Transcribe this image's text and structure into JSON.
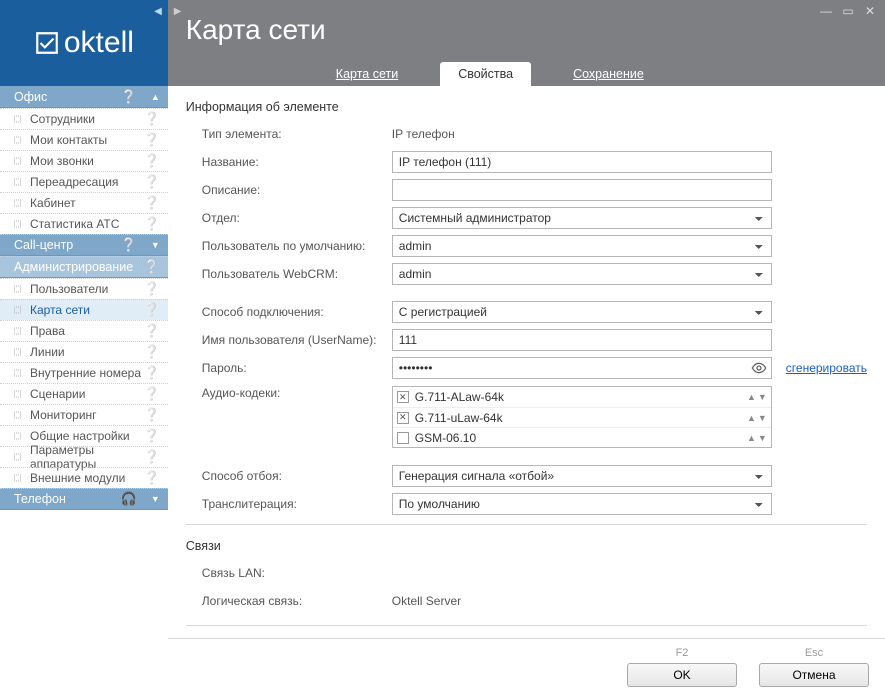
{
  "brand": {
    "name": "oktell"
  },
  "sidebar": {
    "sections": [
      {
        "label": "Офис",
        "style": "dark",
        "expanded": true,
        "items": [
          {
            "label": "Сотрудники"
          },
          {
            "label": "Мои контакты"
          },
          {
            "label": "Мои звонки"
          },
          {
            "label": "Переадресация"
          },
          {
            "label": "Кабинет"
          },
          {
            "label": "Статистика АТС"
          }
        ]
      },
      {
        "label": "Call-центр",
        "style": "dark",
        "expanded": false,
        "items": []
      },
      {
        "label": "Администрирование",
        "style": "light",
        "expanded": true,
        "items": [
          {
            "label": "Пользователи"
          },
          {
            "label": "Карта сети",
            "active": true
          },
          {
            "label": "Права"
          },
          {
            "label": "Линии"
          },
          {
            "label": "Внутренние номера"
          },
          {
            "label": "Сценарии"
          },
          {
            "label": "Мониторинг"
          },
          {
            "label": "Общие настройки"
          },
          {
            "label": "Параметры аппаратуры"
          },
          {
            "label": "Внешние модули"
          }
        ]
      },
      {
        "label": "Телефон",
        "style": "dark",
        "expanded": false,
        "items": []
      }
    ]
  },
  "header": {
    "title": "Карта сети",
    "tabs": [
      {
        "label": "Карта сети"
      },
      {
        "label": "Свойства",
        "active": true
      },
      {
        "label": "Сохранение"
      }
    ]
  },
  "form": {
    "group1_title": "Информация об элементе",
    "type_label": "Тип элемента:",
    "type_value": "IP телефон",
    "name_label": "Название:",
    "name_value": "IP телефон (111)",
    "desc_label": "Описание:",
    "desc_value": "",
    "dept_label": "Отдел:",
    "dept_value": "Системный администратор",
    "user_label": "Пользователь по умолчанию:",
    "user_value": "admin",
    "webcrm_label": "Пользователь WebCRM:",
    "webcrm_value": "admin",
    "conn_label": "Способ подключения:",
    "conn_value": "С регистрацией",
    "uname_label": "Имя пользователя (UserName):",
    "uname_value": "111",
    "pw_label": "Пароль:",
    "pw_value": "••••••••",
    "gen_link": "сгенерировать",
    "codec_label": "Аудио-кодеки:",
    "codecs": [
      {
        "name": "G.711-ALaw-64k",
        "checked": true
      },
      {
        "name": "G.711-uLaw-64k",
        "checked": true
      },
      {
        "name": "GSM-06.10",
        "checked": false
      }
    ],
    "hang_label": "Способ отбоя:",
    "hang_value": "Генерация сигнала «отбой»",
    "trans_label": "Транслитерация:",
    "trans_value": "По умолчанию",
    "group2_title": "Связи",
    "lan_label": "Связь LAN:",
    "lan_value": "",
    "logic_label": "Логическая связь:",
    "logic_value": "Oktell Server"
  },
  "footer": {
    "ok_key": "F2",
    "ok_label": "OK",
    "cancel_key": "Esc",
    "cancel_label": "Отмена"
  }
}
